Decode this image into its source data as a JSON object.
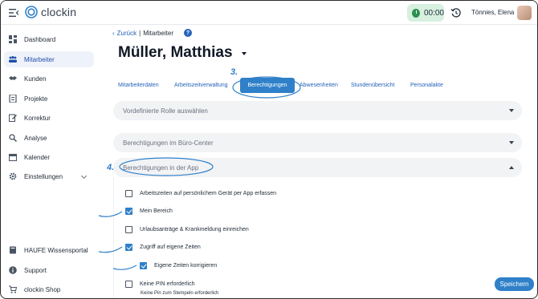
{
  "header": {
    "app_name": "clockin",
    "timer": "00:00",
    "user_name": "Tönnies, Elena",
    "brand_color": "#2f80c9"
  },
  "sidebar": {
    "items": [
      {
        "label": "Dashboard",
        "icon": "dashboard-icon"
      },
      {
        "label": "Mitarbeiter",
        "icon": "people-icon",
        "active": true
      },
      {
        "label": "Kunden",
        "icon": "handshake-icon"
      },
      {
        "label": "Projekte",
        "icon": "list-icon"
      },
      {
        "label": "Korrektur",
        "icon": "edit-icon"
      },
      {
        "label": "Analyse",
        "icon": "search-icon"
      },
      {
        "label": "Kalender",
        "icon": "calendar-icon"
      },
      {
        "label": "Einstellungen",
        "icon": "gear-icon"
      }
    ],
    "bottom_items": [
      {
        "label": "HAUFE Wissensportal",
        "icon": "book-icon"
      },
      {
        "label": "Support",
        "icon": "info-icon"
      },
      {
        "label": "clockin Shop",
        "icon": "cart-icon"
      }
    ]
  },
  "breadcrumb": {
    "back": "Zurück",
    "separator": "|",
    "current": "Mitarbeiter",
    "help": "?"
  },
  "page_title": "Müller, Matthias",
  "tabs": [
    "Mitarbeiterdaten",
    "Arbeitszeitverwaltung",
    "Berechtigungen",
    "Abwesenheiten",
    "Stundenübersicht",
    "Personalakte"
  ],
  "active_tab": "Berechtigungen",
  "sections": {
    "role_select": "Vordefinierte Rolle auswählen",
    "office_permissions": "Berechtigungen im Büro-Center",
    "app_permissions": "Berechtigungen in der App"
  },
  "permissions": [
    {
      "label": "Arbeitszeiten auf persönlichem Gerät per App erfassen",
      "checked": false
    },
    {
      "label": "Mein Bereich",
      "checked": true
    },
    {
      "label": "Urlaubsanträge & Krankmeldung einreichen",
      "checked": false
    },
    {
      "label": "Zugriff auf eigene Zeiten",
      "checked": true
    },
    {
      "label": "Eigene Zeiten korrigieren",
      "checked": true
    },
    {
      "label": "Keine PIN erforderlich",
      "checked": false
    }
  ],
  "pin_subtext": "Keine Pin zum Stempeln erforderlich",
  "annotations": {
    "step3": "3.",
    "step4": "4."
  },
  "save_label": "Speichern"
}
